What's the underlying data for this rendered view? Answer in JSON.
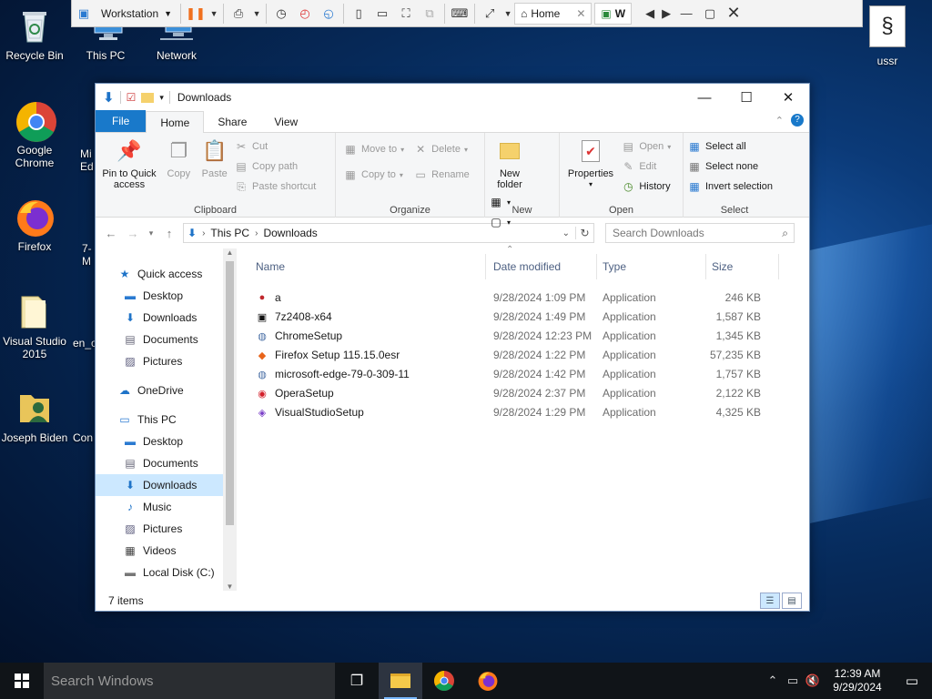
{
  "desktop": {
    "icons": [
      {
        "label": "Recycle Bin"
      },
      {
        "label": "This PC"
      },
      {
        "label": "Network"
      },
      {
        "label": "Google Chrome"
      },
      {
        "label": "Firefox"
      },
      {
        "label": "Visual Studio 2015"
      },
      {
        "label": "Joseph Biden"
      },
      {
        "label": "ussr"
      }
    ],
    "partial_labels": [
      "Mi",
      "Ed",
      "7-",
      "M",
      "en_o",
      "Con"
    ]
  },
  "vm_toolbar": {
    "vm_name": "Workstation",
    "tabs": [
      {
        "label": "Home"
      },
      {
        "label": "W"
      }
    ]
  },
  "explorer": {
    "title": "Downloads",
    "ribbon_tabs": [
      "File",
      "Home",
      "Share",
      "View"
    ],
    "ribbon": {
      "clipboard": {
        "label": "Clipboard",
        "pin": "Pin to Quick access",
        "copy": "Copy",
        "paste": "Paste",
        "cut": "Cut",
        "copy_path": "Copy path",
        "paste_shortcut": "Paste shortcut"
      },
      "organize": {
        "label": "Organize",
        "move_to": "Move to",
        "copy_to": "Copy to",
        "delete": "Delete",
        "rename": "Rename"
      },
      "new": {
        "label": "New",
        "new_folder": "New folder"
      },
      "open": {
        "label": "Open",
        "properties": "Properties",
        "open": "Open",
        "edit": "Edit",
        "history": "History"
      },
      "select": {
        "label": "Select",
        "select_all": "Select all",
        "select_none": "Select none",
        "invert": "Invert selection"
      }
    },
    "address": {
      "crumbs": [
        "This PC",
        "Downloads"
      ],
      "search_placeholder": "Search Downloads"
    },
    "nav_pane": [
      {
        "label": "Quick access",
        "level": 0,
        "icon": "star-icon"
      },
      {
        "label": "Desktop",
        "level": 1,
        "icon": "desktop-icon",
        "pinned": true
      },
      {
        "label": "Downloads",
        "level": 1,
        "icon": "download-icon",
        "pinned": true
      },
      {
        "label": "Documents",
        "level": 1,
        "icon": "document-icon",
        "pinned": true
      },
      {
        "label": "Pictures",
        "level": 1,
        "icon": "pictures-icon",
        "pinned": true
      },
      {
        "label": "OneDrive",
        "level": 0,
        "icon": "cloud-icon"
      },
      {
        "label": "This PC",
        "level": 0,
        "icon": "computer-icon"
      },
      {
        "label": "Desktop",
        "level": 1,
        "icon": "desktop-icon"
      },
      {
        "label": "Documents",
        "level": 1,
        "icon": "document-icon"
      },
      {
        "label": "Downloads",
        "level": 1,
        "icon": "download-icon",
        "selected": true
      },
      {
        "label": "Music",
        "level": 1,
        "icon": "music-icon"
      },
      {
        "label": "Pictures",
        "level": 1,
        "icon": "pictures-icon"
      },
      {
        "label": "Videos",
        "level": 1,
        "icon": "video-icon"
      },
      {
        "label": "Local Disk (C:)",
        "level": 1,
        "icon": "disk-icon"
      }
    ],
    "columns": {
      "name": "Name",
      "date": "Date modified",
      "type": "Type",
      "size": "Size"
    },
    "files": [
      {
        "name": "a",
        "date": "9/28/2024 1:09 PM",
        "type": "Application",
        "size": "246 KB",
        "icon": "red-app-icon"
      },
      {
        "name": "7z2408-x64",
        "date": "9/28/2024 1:49 PM",
        "type": "Application",
        "size": "1,587 KB",
        "icon": "7zip-icon"
      },
      {
        "name": "ChromeSetup",
        "date": "9/28/2024 12:23 PM",
        "type": "Application",
        "size": "1,345 KB",
        "icon": "installer-icon"
      },
      {
        "name": "Firefox Setup 115.15.0esr",
        "date": "9/28/2024 1:22 PM",
        "type": "Application",
        "size": "57,235 KB",
        "icon": "firefox-icon"
      },
      {
        "name": "microsoft-edge-79-0-309-11",
        "date": "9/28/2024 1:42 PM",
        "type": "Application",
        "size": "1,757 KB",
        "icon": "installer-icon"
      },
      {
        "name": "OperaSetup",
        "date": "9/28/2024 2:37 PM",
        "type": "Application",
        "size": "2,122 KB",
        "icon": "opera-icon"
      },
      {
        "name": "VisualStudioSetup",
        "date": "9/28/2024 1:29 PM",
        "type": "Application",
        "size": "4,325 KB",
        "icon": "visual-studio-icon"
      }
    ],
    "status": "7 items"
  },
  "taskbar": {
    "search_placeholder": "Search Windows",
    "time": "12:39 AM",
    "date": "9/29/2024"
  },
  "colors": {
    "accent": "#1979ca",
    "selection": "#cce8ff",
    "taskbar": "#101418"
  }
}
